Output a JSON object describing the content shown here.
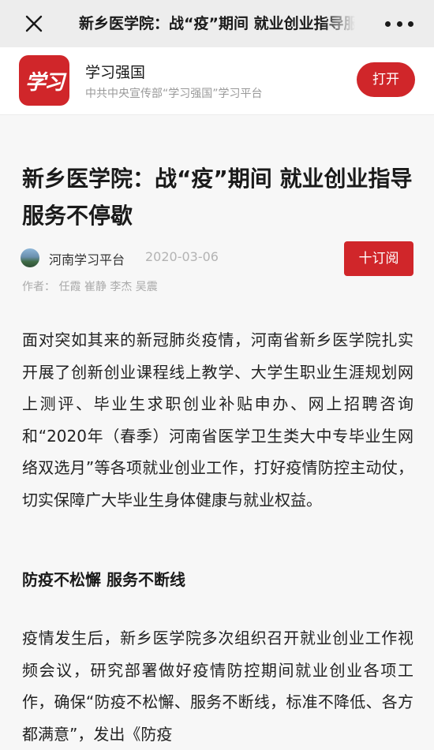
{
  "window": {
    "title": "新乡医学院：战“疫”期间 就业创业指导服务不停歇"
  },
  "app_banner": {
    "logo_text": "学习",
    "name": "学习强国",
    "description": "中共中央宣传部“学习强国”学习平台",
    "open_label": "打开",
    "brand_color": "#d0262a"
  },
  "article": {
    "title": "新乡医学院：战“疫”期间  就业创业指导服务不停歇",
    "source": "河南学习平台",
    "date": "2020-03-06",
    "subscribe_label": "十订阅",
    "authors": "作者：  任霞  崔静  李杰  吴震",
    "paragraph_1": "面对突如其来的新冠肺炎疫情，河南省新乡医学院扎实开展了创新创业课程线上教学、大学生职业生涯规划网上测评、毕业生求职创业补贴申办、网上招聘咨询和“2020年（春季）河南省医学卫生类大中专毕业生网络双选月”等各项就业创业工作，打好疫情防控主动仗，切实保障广大毕业生身体健康与就业权益。",
    "section_heading": "防疫不松懈 服务不断线",
    "paragraph_2": "疫情发生后，新乡医学院多次组织召开就业创业工作视频会议，研究部署做好疫情防控期间就业创业各项工作，确保“防疫不松懈、服务不断线，标准不降低、各方都满意”，发出《防疫"
  },
  "icons": {
    "close": "close-icon",
    "more": "more-icon",
    "avatar": "source-avatar"
  }
}
